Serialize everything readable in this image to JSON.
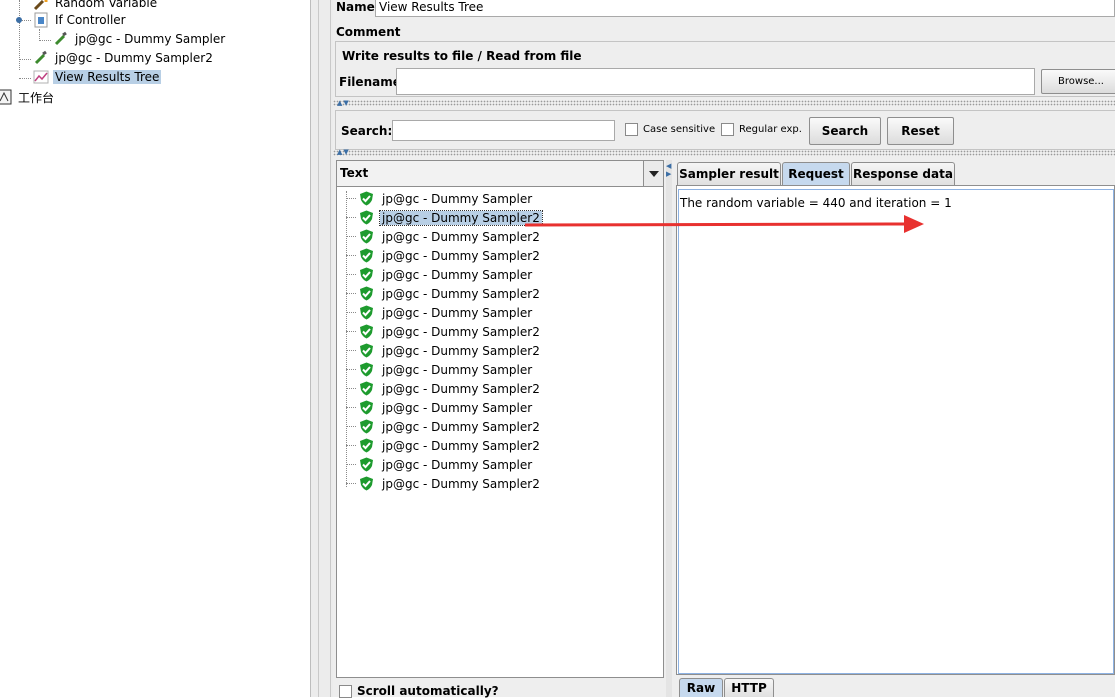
{
  "tree": {
    "items": [
      {
        "label": "Random Variable",
        "icon": "wrench-icon"
      },
      {
        "label": "If Controller",
        "icon": "controller-icon"
      },
      {
        "label": "jp@gc - Dummy Sampler",
        "icon": "pipette-icon"
      },
      {
        "label": "jp@gc - Dummy Sampler2",
        "icon": "pipette-icon"
      },
      {
        "label": "View Results Tree",
        "icon": "chart-icon",
        "selected": true
      },
      {
        "label": "工作台",
        "icon": "workbench-icon"
      }
    ]
  },
  "form": {
    "name_label": "Name:",
    "name_value": "View Results Tree",
    "comments_label": "Comments:",
    "file_section_title": "Write results to file / Read from file",
    "filename_label": "Filename",
    "filename_value": "",
    "browse_label": "Browse..."
  },
  "search": {
    "label": "Search:",
    "value": "",
    "case_sensitive_label": "Case sensitive",
    "regex_label": "Regular exp.",
    "search_button": "Search",
    "reset_button": "Reset"
  },
  "results": {
    "header": "Text",
    "items": [
      "jp@gc - Dummy Sampler",
      "jp@gc - Dummy Sampler2",
      "jp@gc - Dummy Sampler2",
      "jp@gc - Dummy Sampler2",
      "jp@gc - Dummy Sampler",
      "jp@gc - Dummy Sampler2",
      "jp@gc - Dummy Sampler",
      "jp@gc - Dummy Sampler2",
      "jp@gc - Dummy Sampler2",
      "jp@gc - Dummy Sampler",
      "jp@gc - Dummy Sampler2",
      "jp@gc - Dummy Sampler",
      "jp@gc - Dummy Sampler2",
      "jp@gc - Dummy Sampler2",
      "jp@gc - Dummy Sampler",
      "jp@gc - Dummy Sampler2"
    ],
    "selected_index": 1,
    "scroll_auto_label": "Scroll automatically?"
  },
  "detail": {
    "tabs": [
      "Sampler result",
      "Request",
      "Response data"
    ],
    "active_tab": "Request",
    "content": "The random variable = 440 and iteration = 1",
    "bottom_tabs": [
      "Raw",
      "HTTP"
    ],
    "active_bottom_tab": "Raw"
  },
  "colors": {
    "selection": "#b8cfe5",
    "panel_bg": "#eeeeee",
    "annotation_arrow": "#e8312f",
    "success_shield": "#1e9b2e"
  }
}
